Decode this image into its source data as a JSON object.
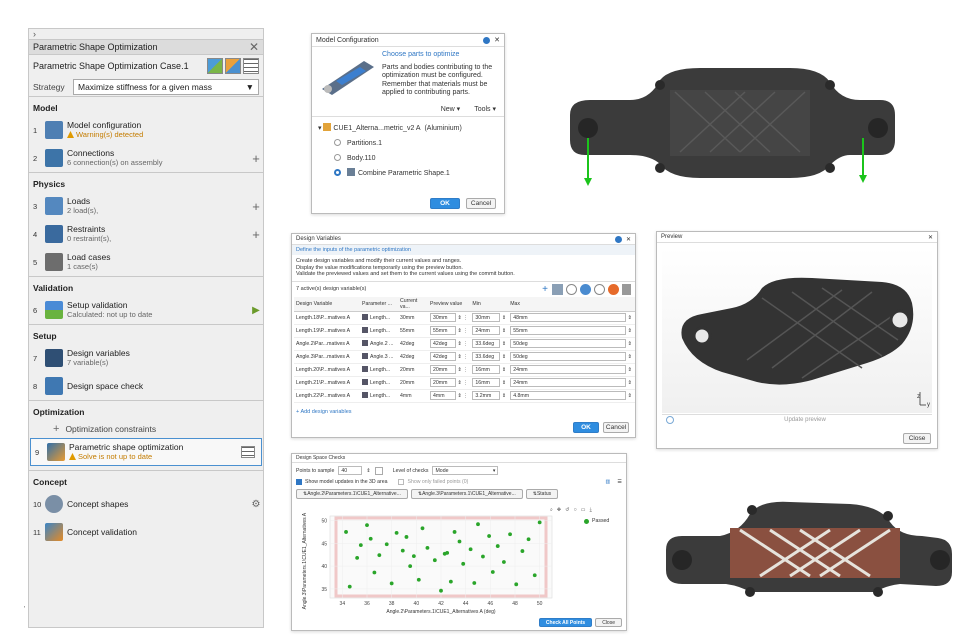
{
  "left_panel": {
    "chevron": "›",
    "title": "Parametric Shape Optimization",
    "close": "✕",
    "case_name": "Parametric Shape Optimization Case.1",
    "strategy_label": "Strategy",
    "strategy_value": "Maximize stiffness for a given mass",
    "sections": {
      "model": "Model",
      "physics": "Physics",
      "validation": "Validation",
      "setup": "Setup",
      "optimization": "Optimization",
      "concept": "Concept"
    },
    "items": {
      "model_config": {
        "num": "1",
        "label": "Model configuration",
        "sub": "Warning(s) detected"
      },
      "connections": {
        "num": "2",
        "label": "Connections",
        "sub": "6 connection(s) on assembly"
      },
      "loads": {
        "num": "3",
        "label": "Loads",
        "sub": "2 load(s),"
      },
      "restraints": {
        "num": "4",
        "label": "Restraints",
        "sub": "0 restraint(s),"
      },
      "load_cases": {
        "num": "5",
        "label": "Load cases",
        "sub": "1 case(s)"
      },
      "setup_validation": {
        "num": "6",
        "label": "Setup validation",
        "sub": "Calculated: not up to date"
      },
      "design_variables": {
        "num": "7",
        "label": "Design variables",
        "sub": "7 variable(s)"
      },
      "design_space_check": {
        "num": "8",
        "label": "Design space check"
      },
      "opt_constraints": {
        "label": "Optimization constraints"
      },
      "pso": {
        "num": "9",
        "label": "Parametric shape optimization",
        "sub": "Solve is not up to date"
      },
      "concept_shapes": {
        "num": "10",
        "label": "Concept shapes"
      },
      "concept_validation": {
        "num": "11",
        "label": "Concept validation"
      }
    },
    "footer_mark": "'"
  },
  "model_config": {
    "title": "Model Configuration",
    "choose": "Choose parts to optimize",
    "desc": "Parts and bodies contributing to the optimization must be configured. Remember that materials must be applied to contributing parts.",
    "new_label": "New",
    "tools_label": "Tools",
    "root_name": "CUE1_Alterna...metric_v2 A",
    "root_material": "(Aluminium)",
    "children": [
      "Partitions.1",
      "Body.110",
      "Combine Parametric Shape.1"
    ],
    "ok": "OK",
    "cancel": "Cancel"
  },
  "design_vars": {
    "title": "Design Variables",
    "subtitle": "Define the inputs of the parametric optimization",
    "desc1": "Create design variables and modify their current values and ranges.",
    "desc2": "Display the value modifications temporarily using the preview button.",
    "desc3": "Validate the previewed values and set them to the current values using the commit button.",
    "count": "7 active(s) design variable(s)",
    "headers": [
      "Design Variable",
      "Parameter ...",
      "Current va...",
      "Preview value",
      "Min",
      "Max"
    ],
    "rows": [
      [
        "Length.18\\P...matives A",
        "Length...",
        "30mm",
        "30mm",
        "30mm",
        "48mm"
      ],
      [
        "Length.19\\P...matives A",
        "Length...",
        "55mm",
        "55mm",
        "24mm",
        "55mm"
      ],
      [
        "Angle.2\\Par...matives A",
        "Angle.2 ...",
        "42deg",
        "42deg",
        "33.6deg",
        "50deg"
      ],
      [
        "Angle.3\\Par...matives A",
        "Angle.3 ...",
        "42deg",
        "42deg",
        "33.6deg",
        "50deg"
      ],
      [
        "Length.20\\P...matives A",
        "Length...",
        "20mm",
        "20mm",
        "16mm",
        "24mm"
      ],
      [
        "Length.21\\P...matives A",
        "Length...",
        "20mm",
        "20mm",
        "16mm",
        "24mm"
      ],
      [
        "Length.22\\P...matives A",
        "Length...",
        "4mm",
        "4mm",
        "3.2mm",
        "4.8mm"
      ]
    ],
    "add": "Add design variables",
    "ok": "OK",
    "cancel": "Cancel"
  },
  "preview": {
    "title": "Preview",
    "update": "Update preview",
    "close": "Close",
    "axis_z": "z",
    "axis_y": "y"
  },
  "design_space": {
    "title": "Design Space Checks",
    "points_label": "Points to sample",
    "points_value": "40",
    "level_label": "Level of checks",
    "level_value": "Mode",
    "show_updates": "Show model updates in the 3D area",
    "show_failed": "Show only failed points (0)",
    "tabs": [
      "Angle.2\\Parameters.1\\CUE1_Alternative...",
      "Angle.3\\Parameters.1\\CUE1_Alternative...",
      "Status"
    ],
    "legend": "Passed",
    "xlabel": "Angle.2\\Parameters.1\\CUE1_Alternatives A (deg)",
    "ylabel": "Angle.3\\Parameters.1\\CUE1_Alternatives A (de",
    "check_all": "Check All Points",
    "close": "Close"
  },
  "chart_data": {
    "type": "scatter",
    "xlabel": "Angle.2\\Parameters.1\\CUE1_Alternatives A (deg)",
    "ylabel": "Angle.3\\Parameters.1\\CUE1_Alternatives A (de",
    "xlim": [
      33,
      51
    ],
    "ylim": [
      33,
      51
    ],
    "xticks": [
      34,
      36,
      38,
      40,
      42,
      44,
      46,
      48,
      50
    ],
    "yticks": [
      35,
      40,
      45,
      50
    ],
    "series": [
      {
        "name": "Passed",
        "color": "#2aa52a",
        "points": [
          [
            34.3,
            47.5
          ],
          [
            34.6,
            35.5
          ],
          [
            35.2,
            41.8
          ],
          [
            35.5,
            44.6
          ],
          [
            36.0,
            49.0
          ],
          [
            36.3,
            46.0
          ],
          [
            36.6,
            38.6
          ],
          [
            37.0,
            42.4
          ],
          [
            37.6,
            44.8
          ],
          [
            38.0,
            36.2
          ],
          [
            38.4,
            47.3
          ],
          [
            38.9,
            43.4
          ],
          [
            39.2,
            46.4
          ],
          [
            39.5,
            40.0
          ],
          [
            39.8,
            42.2
          ],
          [
            40.2,
            37.0
          ],
          [
            40.5,
            48.3
          ],
          [
            40.9,
            44.0
          ],
          [
            41.5,
            41.3
          ],
          [
            42.0,
            34.6
          ],
          [
            42.3,
            42.7
          ],
          [
            42.5,
            42.9
          ],
          [
            42.8,
            36.6
          ],
          [
            43.1,
            47.5
          ],
          [
            43.5,
            45.4
          ],
          [
            43.8,
            40.5
          ],
          [
            44.4,
            43.7
          ],
          [
            44.7,
            36.3
          ],
          [
            45.0,
            49.2
          ],
          [
            45.4,
            42.1
          ],
          [
            45.9,
            46.6
          ],
          [
            46.2,
            38.7
          ],
          [
            46.6,
            44.4
          ],
          [
            47.1,
            40.9
          ],
          [
            47.6,
            47.0
          ],
          [
            48.1,
            36.0
          ],
          [
            48.6,
            43.3
          ],
          [
            49.1,
            45.9
          ],
          [
            49.6,
            38.0
          ],
          [
            50.0,
            49.6
          ]
        ]
      }
    ]
  },
  "colors": {
    "accent": "#2f77c4",
    "passed": "#2aa52a",
    "warning": "#c47c00",
    "part_dark": "#3b3b3b",
    "part_copper": "#8a5040"
  }
}
